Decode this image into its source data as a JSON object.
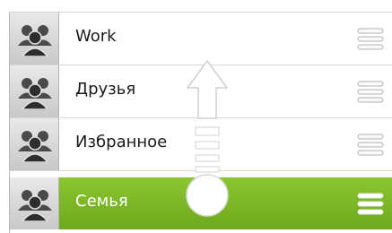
{
  "groups": [
    {
      "name": "Work",
      "icon": "group-avatar-icon"
    },
    {
      "name": "Друзья",
      "icon": "group-avatar-icon"
    },
    {
      "name": "Избранное",
      "icon": "group-avatar-icon"
    },
    {
      "name": "Семья",
      "icon": "group-avatar-icon",
      "selected": true
    }
  ],
  "colors": {
    "accent": "#7bb625",
    "avatar_bg": "#d9d9d9",
    "handle": "#bdbdbd"
  },
  "icons": {
    "drag_handle": "drag-handle-icon",
    "gesture": "swipe-up-arrow-icon"
  }
}
